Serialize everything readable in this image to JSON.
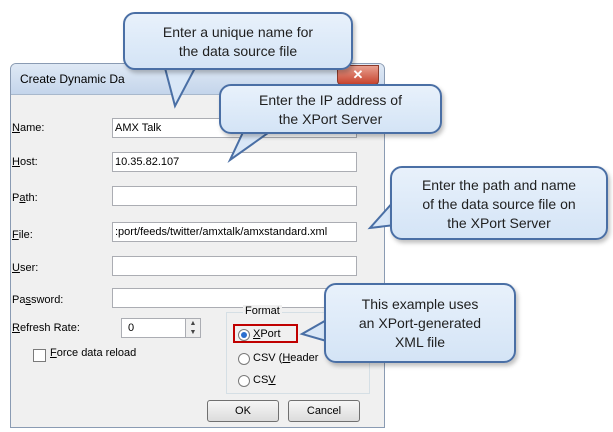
{
  "dialog": {
    "title": "Create Dynamic Da",
    "close_glyph": "✕",
    "labels": {
      "name_u": "N",
      "name_rest": "ame:",
      "host_u": "H",
      "host_rest": "ost:",
      "path_pre": "P",
      "path_u": "a",
      "path_rest": "th:",
      "file_u": "F",
      "file_rest": "ile:",
      "user_u": "U",
      "user_rest": "ser:",
      "password_pre": "Pa",
      "password_u": "s",
      "password_rest": "sword:",
      "refresh_u": "R",
      "refresh_rest": "efresh Rate:"
    },
    "values": {
      "name": "AMX Talk",
      "host": "10.35.82.107",
      "path": "",
      "file": ":port/feeds/twitter/amxtalk/amxstandard.xml",
      "user": "",
      "password": "",
      "refresh_rate": "0"
    },
    "force_reload_u": "F",
    "force_reload_rest": "orce data reload",
    "force_reload_checked": false,
    "format": {
      "label": "Format",
      "options": [
        {
          "u": "X",
          "rest": "Port",
          "selected": true
        },
        {
          "pre": "CSV (",
          "u": "H",
          "rest": "eader",
          "selected": false
        },
        {
          "pre": "CS",
          "u": "V",
          "rest": "",
          "selected": false
        }
      ]
    },
    "ok_label": "OK",
    "cancel_label": "Cancel"
  },
  "callouts": {
    "name": [
      "Enter a unique name for",
      "the data source file"
    ],
    "ip": [
      "Enter the IP address of",
      "the XPort Server"
    ],
    "path": [
      "Enter the path and name",
      "of the data source file on",
      "the XPort Server"
    ],
    "example": [
      "This example uses",
      "an XPort-generated",
      "XML file"
    ]
  },
  "colors": {
    "callout_border": "#4a6fa5",
    "highlight_box": "#c00000"
  }
}
